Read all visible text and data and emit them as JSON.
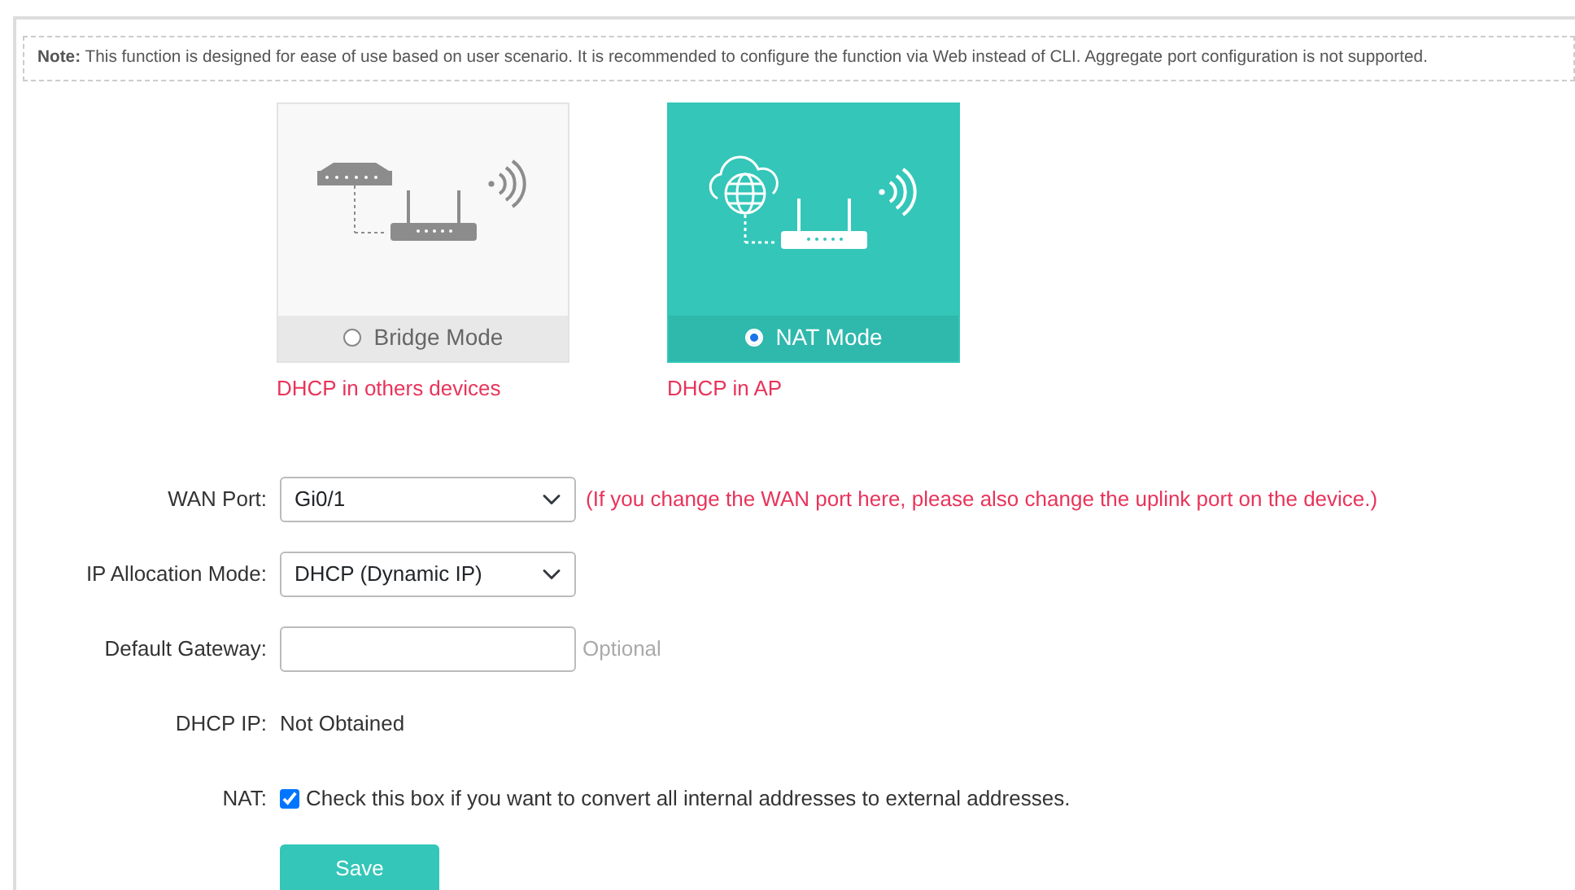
{
  "note": {
    "label": "Note:",
    "text": "This function is designed for ease of use based on user scenario. It is recommended to configure the function via Web instead of CLI. Aggregate port configuration is not supported."
  },
  "modes": [
    {
      "kind": "bridge",
      "label": "Bridge Mode",
      "selected": false,
      "caption": "DHCP in others devices"
    },
    {
      "kind": "nat",
      "label": "NAT Mode",
      "selected": true,
      "caption": "DHCP in AP"
    }
  ],
  "form": [
    {
      "kind": "select",
      "label": "WAN Port:",
      "value": "Gi0/1",
      "hint": "(If you change the WAN port here, please also change the uplink port on the device.)"
    },
    {
      "kind": "select",
      "label": "IP Allocation Mode:",
      "value": "DHCP (Dynamic IP)"
    },
    {
      "kind": "input",
      "label": "Default Gateway:",
      "hint": "Optional"
    },
    {
      "kind": "text",
      "label": "DHCP IP:",
      "value": "Not Obtained"
    },
    {
      "kind": "checkbox",
      "label": "NAT:",
      "checked": true,
      "value": "Check this box if you want to convert all internal addresses to external addresses."
    }
  ],
  "save_button": "Save"
}
